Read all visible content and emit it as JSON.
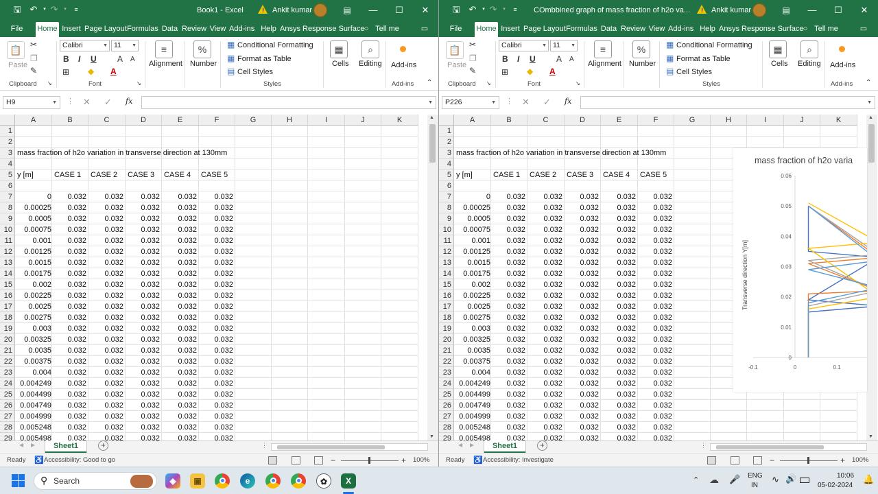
{
  "windows": [
    {
      "title": "Book1  -  Excel",
      "user": "Ankit kumar",
      "name_box": "H9",
      "accessibility": "Accessibility: Good to go",
      "show_chart": false
    },
    {
      "title": "COmbbined graph of mass fraction of h2o va...",
      "user": "Ankit kumar",
      "name_box": "P226",
      "accessibility": "Accessibility: Investigate",
      "show_chart": true
    }
  ],
  "menu": [
    "File",
    "Home",
    "Insert",
    "Page Layout",
    "Formulas",
    "Data",
    "Review",
    "View",
    "Add-ins",
    "Help",
    "Ansys Response Surface",
    "Tell me"
  ],
  "ribbon": {
    "paste": "Paste",
    "clipboard": "Clipboard",
    "font_name": "Calibri",
    "font_size": "11",
    "font": "Font",
    "alignment": "Alignment",
    "number": "Number",
    "percent": "%",
    "conditional_formatting": "Conditional Formatting",
    "format_as_table": "Format as Table",
    "cell_styles": "Cell Styles",
    "styles": "Styles",
    "cells": "Cells",
    "editing": "Editing",
    "addins": "Add-ins",
    "bold": "B",
    "italic": "I",
    "underline": "U",
    "grow": "A",
    "shrink": "A",
    "fontcolor": "A"
  },
  "fx_label": "fx",
  "columns": [
    "A",
    "B",
    "C",
    "D",
    "E",
    "F",
    "G",
    "H",
    "I",
    "J",
    "K"
  ],
  "rows": [
    "1",
    "2",
    "3",
    "4",
    "5",
    "6",
    "7",
    "8",
    "9",
    "10",
    "11",
    "12",
    "13",
    "14",
    "15",
    "16",
    "17",
    "18",
    "19",
    "20",
    "21",
    "22",
    "23",
    "24",
    "25",
    "26",
    "27",
    "28",
    "29"
  ],
  "sheet": {
    "title_cell": "mass fraction of h2o variation  in transverse direction at 130mm",
    "headers": [
      "y [m]",
      "CASE 1",
      "CASE 2",
      "CASE 3",
      "CASE 4",
      "CASE 5"
    ],
    "y_values": [
      "0",
      "0.00025",
      "0.0005",
      "0.00075",
      "0.001",
      "0.00125",
      "0.0015",
      "0.00175",
      "0.002",
      "0.00225",
      "0.0025",
      "0.00275",
      "0.003",
      "0.00325",
      "0.0035",
      "0.00375",
      "0.004",
      "0.004249",
      "0.004499",
      "0.004749",
      "0.004999",
      "0.005248",
      "0.005498"
    ],
    "case_value": "0.032"
  },
  "sheet_tab": "Sheet1",
  "status": {
    "ready": "Ready",
    "zoom": "100%"
  },
  "chart": {
    "title_visible": "mass fraction of h2o varia",
    "ylabel": "Transverse direction Y[m]",
    "yticks": [
      "0.06",
      "0.05",
      "0.04",
      "0.03",
      "0.02",
      "0.01",
      "0"
    ],
    "xticks": [
      "-0.1",
      "0",
      "0.1"
    ],
    "colors": [
      "#4472c4",
      "#ed7d31",
      "#a5a5a5",
      "#ffc000",
      "#5b9bd5"
    ]
  },
  "chart_data": {
    "type": "line",
    "title": "mass fraction of h2o varia",
    "xlabel": "",
    "ylabel": "Transverse direction Y[m]",
    "xlim": [
      -0.1,
      0.1
    ],
    "ylim": [
      0,
      0.06
    ],
    "series": [
      {
        "name": "CASE 1",
        "x": [
          0.032,
          0.032,
          0.2,
          0.032,
          0.2,
          0.032,
          0.032
        ],
        "y": [
          0,
          0.015,
          0.017,
          0.019,
          0.033,
          0.035,
          0.05
        ]
      },
      {
        "name": "CASE 2",
        "x": [
          0.032,
          0.032,
          0.2,
          0.032,
          0.2,
          0.032
        ],
        "y": [
          0,
          0.021,
          0.022,
          0.031,
          0.033,
          0.05
        ]
      },
      {
        "name": "CASE 3",
        "x": [
          0.032,
          0.032,
          0.2,
          0.032,
          0.2,
          0.032
        ],
        "y": [
          0,
          0.017,
          0.022,
          0.032,
          0.034,
          0.05
        ]
      },
      {
        "name": "CASE 4",
        "x": [
          0.032,
          0.032,
          0.2,
          0.032,
          0.2,
          0.032
        ],
        "y": [
          0,
          0.016,
          0.02,
          0.036,
          0.038,
          0.051
        ]
      },
      {
        "name": "CASE 5",
        "x": [
          0.032,
          0.032,
          0.2,
          0.032,
          0.2,
          0.032
        ],
        "y": [
          0,
          0.018,
          0.023,
          0.029,
          0.032,
          0.05
        ]
      }
    ]
  },
  "taskbar": {
    "search": "Search",
    "lang1": "ENG",
    "lang2": "IN",
    "time": "10:06",
    "date": "05-02-2024"
  }
}
